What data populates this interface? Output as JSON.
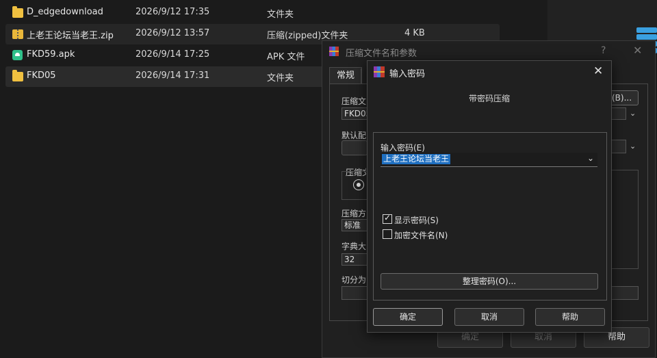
{
  "files": [
    {
      "name": "D_edgedownload",
      "date": "2026/9/12 17:35",
      "type": "文件夹",
      "size": "",
      "icon": "folder-icon"
    },
    {
      "name": "上老王论坛当老王.zip",
      "date": "2026/9/12 13:57",
      "type": "压缩(zipped)文件夹",
      "size": "4 KB",
      "icon": "zip-folder-icon"
    },
    {
      "name": "FKD59.apk",
      "date": "2026/9/14 17:25",
      "type": "APK 文件",
      "size": "",
      "icon": "apk-icon"
    },
    {
      "name": "FKD05",
      "date": "2026/9/14 17:31",
      "type": "文件夹",
      "size": "",
      "icon": "folder-icon"
    }
  ],
  "bg_dialog": {
    "title": "压缩文件名和参数",
    "help_glyph": "?",
    "tab_general": "常规",
    "archive_name_label": "压缩文件名",
    "archive_name_value": "FKD05",
    "browse_label": "(B)...",
    "profile_label": "默认配置",
    "archive_format_label": "压缩文件格式",
    "method_label": "压缩方式",
    "method_value": "标准",
    "dict_label": "字典大小",
    "dict_value": "32",
    "split_label": "切分为分卷",
    "ok_label": "确定",
    "cancel_label": "取消",
    "help_label": "帮助"
  },
  "dialog": {
    "title": "输入密码",
    "subtitle": "带密码压缩",
    "password_label": "输入密码(E)",
    "password_value": "上老王论坛当老王",
    "show_password_label": "显示密码(S)",
    "show_password_checked": true,
    "encrypt_names_label": "加密文件名(N)",
    "encrypt_names_checked": false,
    "organize_label": "整理密码(O)...",
    "ok_label": "确定",
    "cancel_label": "取消",
    "help_label": "帮助"
  },
  "colors": {
    "background": "#1b1b1b",
    "selection": "#1f6fc0",
    "folder": "#f0c040",
    "apk": "#2fc08a"
  }
}
